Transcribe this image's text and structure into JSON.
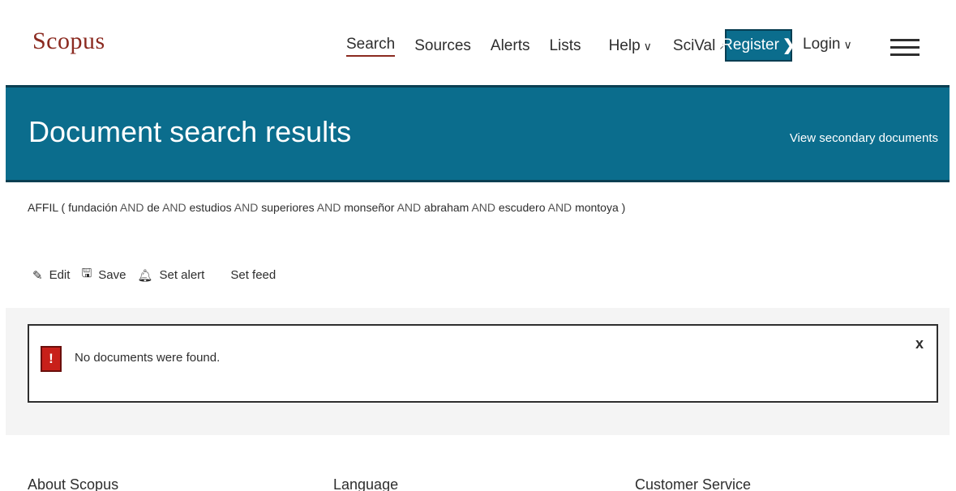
{
  "header": {
    "logo": "Scopus",
    "nav": [
      {
        "label": "Search",
        "active": true
      },
      {
        "label": "Sources"
      },
      {
        "label": "Alerts"
      },
      {
        "label": "Lists"
      },
      {
        "label": "Help",
        "caret": "∨"
      },
      {
        "label": "SciVal",
        "ext": "↗"
      }
    ],
    "register_label": "Register",
    "register_chevron": "❯",
    "login_label": "Login",
    "login_caret": "∨"
  },
  "banner": {
    "title": "Document search results",
    "secondary_link": "View secondary documents"
  },
  "query": {
    "field": "AFFIL",
    "open": "(",
    "close": ")",
    "terms": [
      "fundación",
      "de",
      "estudios",
      "superiores",
      "monseñor",
      "abraham",
      "escudero",
      "montoya"
    ],
    "operator": "AND"
  },
  "actions": {
    "edit": "Edit",
    "save": "Save",
    "set_alert": "Set alert",
    "set_feed": "Set feed"
  },
  "message": {
    "icon_text": "!",
    "text": "No documents were found.",
    "close": "x"
  },
  "footer": {
    "col1": "About Scopus",
    "col2": "Language",
    "col3": "Customer Service"
  },
  "colors": {
    "brand": "#8b2a20",
    "banner": "#0b6d8d",
    "alert": "#c8201a"
  }
}
